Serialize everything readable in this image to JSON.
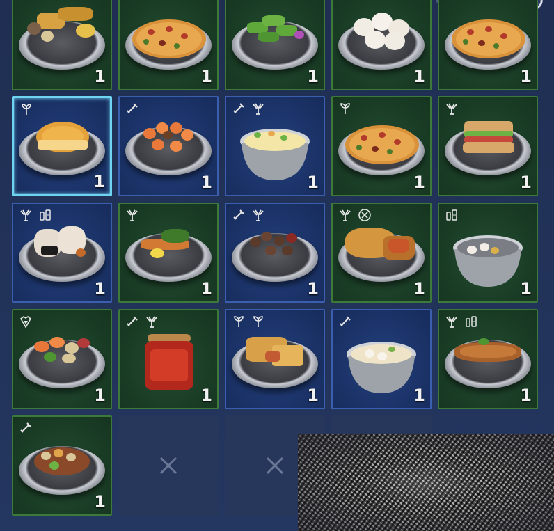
{
  "colors": {
    "accent_selected": "#6fd3f2",
    "cell_green": "#1a3d26",
    "cell_blue": "#1b3368",
    "background": "#22335a"
  },
  "cells": [
    {
      "row": 0,
      "col": 0,
      "quantity": "1",
      "rarity": "green",
      "food": "fried-platter",
      "buffs": []
    },
    {
      "row": 0,
      "col": 1,
      "quantity": "1",
      "rarity": "green",
      "food": "pizza",
      "buffs": []
    },
    {
      "row": 0,
      "col": 2,
      "quantity": "1",
      "rarity": "green",
      "food": "vegetable-rolls",
      "buffs": []
    },
    {
      "row": 0,
      "col": 3,
      "quantity": "1",
      "rarity": "green",
      "food": "steamed-buns",
      "buffs": []
    },
    {
      "row": 0,
      "col": 4,
      "quantity": "1",
      "rarity": "green",
      "food": "pizza",
      "buffs": []
    },
    {
      "row": 1,
      "col": 0,
      "quantity": "1",
      "rarity": "blue",
      "food": "pineapple-bun",
      "buffs": [
        "sprout-icon"
      ],
      "selected": true
    },
    {
      "row": 1,
      "col": 1,
      "quantity": "1",
      "rarity": "blue",
      "food": "shrimp-platter",
      "buffs": [
        "bone-icon"
      ]
    },
    {
      "row": 1,
      "col": 2,
      "quantity": "1",
      "rarity": "blue",
      "food": "creamy-soup",
      "buffs": [
        "bone-icon",
        "claw-icon"
      ]
    },
    {
      "row": 1,
      "col": 3,
      "quantity": "1",
      "rarity": "green",
      "food": "pizza",
      "buffs": [
        "sprout-icon"
      ]
    },
    {
      "row": 1,
      "col": 4,
      "quantity": "1",
      "rarity": "green",
      "food": "sandwich",
      "buffs": [
        "claw-icon"
      ]
    },
    {
      "row": 2,
      "col": 0,
      "quantity": "1",
      "rarity": "blue",
      "food": "rice-balls",
      "buffs": [
        "claw-icon",
        "potion-icon"
      ]
    },
    {
      "row": 2,
      "col": 1,
      "quantity": "1",
      "rarity": "green",
      "food": "fried-shrimp",
      "buffs": [
        "claw-icon"
      ]
    },
    {
      "row": 2,
      "col": 2,
      "quantity": "1",
      "rarity": "blue",
      "food": "braised-mushrooms",
      "buffs": [
        "bone-icon",
        "claw-icon"
      ]
    },
    {
      "row": 2,
      "col": 3,
      "quantity": "1",
      "rarity": "green",
      "food": "meat-pie",
      "buffs": [
        "claw-icon",
        "shield-cross-icon"
      ]
    },
    {
      "row": 2,
      "col": 4,
      "quantity": "1",
      "rarity": "green",
      "food": "dumpling-pot",
      "buffs": [
        "potion-icon"
      ]
    },
    {
      "row": 3,
      "col": 0,
      "quantity": "1",
      "rarity": "green",
      "food": "seafood-stirfry",
      "buffs": [
        "heart-shield-icon"
      ]
    },
    {
      "row": 3,
      "col": 1,
      "quantity": "1",
      "rarity": "green",
      "food": "chili-jar",
      "buffs": [
        "bone-icon",
        "claw-icon"
      ]
    },
    {
      "row": 3,
      "col": 2,
      "quantity": "1",
      "rarity": "blue",
      "food": "pastry-slices",
      "buffs": [
        "sprout-icon",
        "sprout-icon"
      ]
    },
    {
      "row": 3,
      "col": 3,
      "quantity": "1",
      "rarity": "blue",
      "food": "dumpling-soup",
      "buffs": [
        "bone-icon"
      ]
    },
    {
      "row": 3,
      "col": 4,
      "quantity": "1",
      "rarity": "green",
      "food": "grilled-fish",
      "buffs": [
        "claw-icon",
        "potion-icon"
      ]
    },
    {
      "row": 4,
      "col": 0,
      "quantity": "1",
      "rarity": "green",
      "food": "mixed-stew",
      "buffs": [
        "bone-icon"
      ]
    },
    {
      "row": 4,
      "col": 1,
      "quantity": "",
      "rarity": "empty",
      "food": "",
      "buffs": []
    },
    {
      "row": 4,
      "col": 2,
      "quantity": "",
      "rarity": "empty",
      "food": "",
      "buffs": []
    },
    {
      "row": 4,
      "col": 3,
      "quantity": "",
      "rarity": "empty",
      "food": "",
      "buffs": []
    }
  ]
}
